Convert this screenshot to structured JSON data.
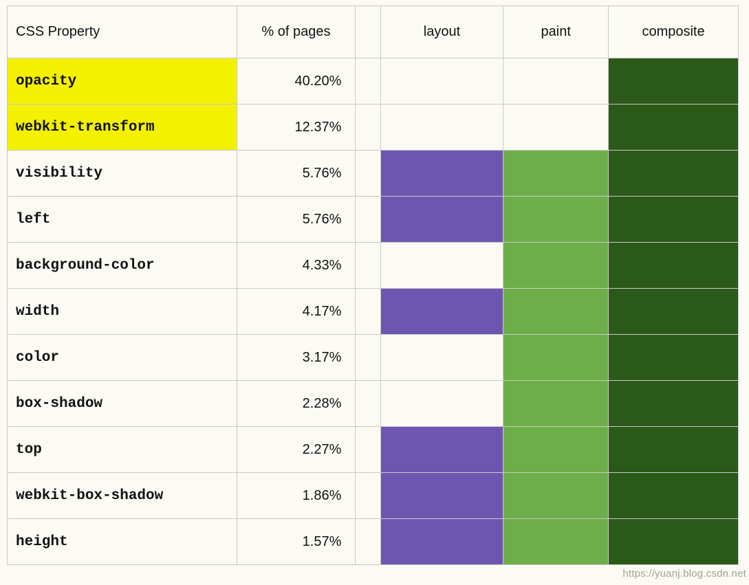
{
  "headers": {
    "property": "CSS Property",
    "percent": "% of pages",
    "layout": "layout",
    "paint": "paint",
    "composite": "composite"
  },
  "rows": [
    {
      "property": "opacity",
      "percent": "40.20%",
      "highlight": true,
      "layout": false,
      "paint": false,
      "composite": true
    },
    {
      "property": "webkit-transform",
      "percent": "12.37%",
      "highlight": true,
      "layout": false,
      "paint": false,
      "composite": true
    },
    {
      "property": "visibility",
      "percent": "5.76%",
      "highlight": false,
      "layout": true,
      "paint": true,
      "composite": true
    },
    {
      "property": "left",
      "percent": "5.76%",
      "highlight": false,
      "layout": true,
      "paint": true,
      "composite": true
    },
    {
      "property": "background-color",
      "percent": "4.33%",
      "highlight": false,
      "layout": false,
      "paint": true,
      "composite": true
    },
    {
      "property": "width",
      "percent": "4.17%",
      "highlight": false,
      "layout": true,
      "paint": true,
      "composite": true
    },
    {
      "property": "color",
      "percent": "3.17%",
      "highlight": false,
      "layout": false,
      "paint": true,
      "composite": true
    },
    {
      "property": "box-shadow",
      "percent": "2.28%",
      "highlight": false,
      "layout": false,
      "paint": true,
      "composite": true
    },
    {
      "property": "top",
      "percent": "2.27%",
      "highlight": false,
      "layout": true,
      "paint": true,
      "composite": true
    },
    {
      "property": "webkit-box-shadow",
      "percent": "1.86%",
      "highlight": false,
      "layout": true,
      "paint": true,
      "composite": true
    },
    {
      "property": "height",
      "percent": "1.57%",
      "highlight": false,
      "layout": true,
      "paint": true,
      "composite": true
    }
  ],
  "colors": {
    "highlight": "#f3f100",
    "layout": "#6d56b1",
    "paint": "#6eae49",
    "composite": "#2b5917"
  },
  "watermark": "https://yuanj.blog.csdn.net",
  "chart_data": {
    "type": "table",
    "title": "",
    "columns": [
      "CSS Property",
      "% of pages",
      "layout",
      "paint",
      "composite"
    ],
    "rows": [
      [
        "opacity",
        40.2,
        false,
        false,
        true
      ],
      [
        "webkit-transform",
        12.37,
        false,
        false,
        true
      ],
      [
        "visibility",
        5.76,
        true,
        true,
        true
      ],
      [
        "left",
        5.76,
        true,
        true,
        true
      ],
      [
        "background-color",
        4.33,
        false,
        true,
        true
      ],
      [
        "width",
        4.17,
        true,
        true,
        true
      ],
      [
        "color",
        3.17,
        false,
        true,
        true
      ],
      [
        "box-shadow",
        2.28,
        false,
        true,
        true
      ],
      [
        "top",
        2.27,
        true,
        true,
        true
      ],
      [
        "webkit-box-shadow",
        1.86,
        true,
        true,
        true
      ],
      [
        "height",
        1.57,
        true,
        true,
        true
      ]
    ]
  }
}
